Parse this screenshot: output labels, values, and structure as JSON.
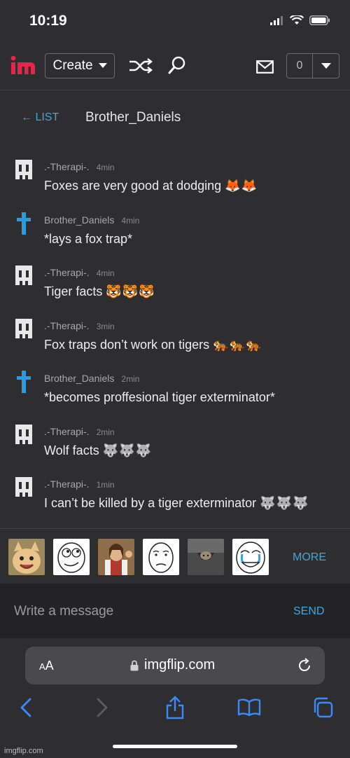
{
  "status_bar": {
    "time": "10:19"
  },
  "nav": {
    "logo": "im",
    "create_label": "Create",
    "notif_count": "0"
  },
  "chat": {
    "back_label": "LIST",
    "title": "Brother_Daniels"
  },
  "messages": [
    {
      "user": ".-Therapi-.",
      "time": "4min",
      "text": "Foxes are very good at dodging",
      "emoji": "🦊🦊",
      "avatar": "ghost"
    },
    {
      "user": "Brother_Daniels",
      "time": "4min",
      "text": "*lays a fox trap*",
      "emoji": "",
      "avatar": "cross"
    },
    {
      "user": ".-Therapi-.",
      "time": "4min",
      "text": "Tiger facts",
      "emoji": "🐯🐯🐯",
      "avatar": "ghost"
    },
    {
      "user": ".-Therapi-.",
      "time": "3min",
      "text": "Fox traps don’t work on tigers",
      "emoji": "🐅🐅🐅",
      "avatar": "ghost"
    },
    {
      "user": "Brother_Daniels",
      "time": "2min",
      "text": "*becomes proffesional tiger exterminator*",
      "emoji": "",
      "avatar": "cross"
    },
    {
      "user": ".-Therapi-.",
      "time": "2min",
      "text": "Wolf facts",
      "emoji": "🐺🐺🐺",
      "avatar": "ghost"
    },
    {
      "user": ".-Therapi-.",
      "time": "1min",
      "text": "I can’t be killed by a tiger exterminator",
      "emoji": "🐺🐺🐺",
      "avatar": "ghost"
    }
  ],
  "meme_bar": {
    "more_label": "MORE"
  },
  "composer": {
    "placeholder": "Write a message",
    "send_label": "SEND"
  },
  "browser": {
    "aa_label": "AA",
    "url": "imgflip.com"
  },
  "watermark": "imgflip.com",
  "colors": {
    "accent": "#3aa8e3",
    "background": "#2e2e30",
    "logo_red": "#e8244a"
  }
}
